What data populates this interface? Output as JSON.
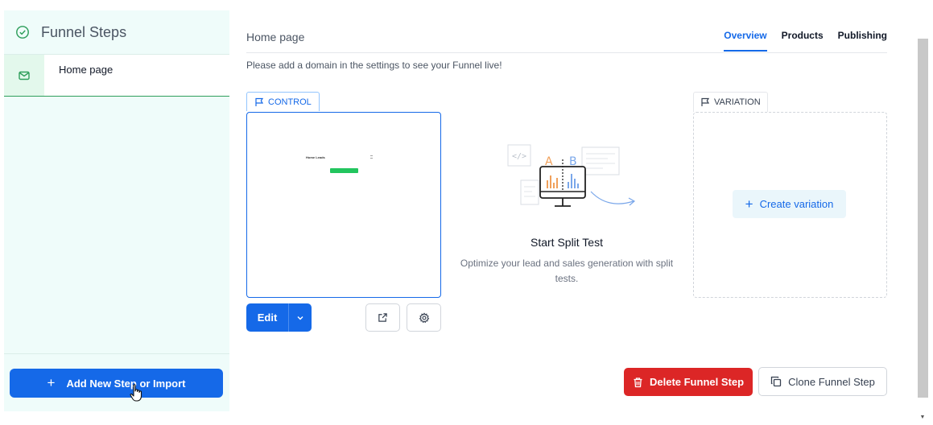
{
  "sidebar": {
    "title": "Funnel Steps",
    "steps": [
      {
        "label": "Home page"
      }
    ],
    "add_button_label": "Add New Step or Import"
  },
  "main": {
    "page_heading": "Home page",
    "tabs": [
      {
        "label": "Overview",
        "active": true
      },
      {
        "label": "Products",
        "active": false
      },
      {
        "label": "Publishing",
        "active": false
      }
    ],
    "notice": "Please add a domain in the settings to see your Funnel live!",
    "control": {
      "tag_label": "CONTROL",
      "thumbnail_title": "Home Leads",
      "edit_label": "Edit"
    },
    "split_test": {
      "label_a": "A",
      "label_b": "B",
      "title": "Start Split Test",
      "description": "Optimize your lead and sales generation with split tests."
    },
    "variation": {
      "tag_label": "VARIATION",
      "create_label": "Create variation"
    },
    "actions": {
      "delete_label": "Delete Funnel Step",
      "clone_label": "Clone Funnel Step"
    }
  },
  "colors": {
    "primary": "#1569e8",
    "success": "#2e9e5b",
    "danger": "#dc2626",
    "sidebar_bg": "#effcfa"
  }
}
